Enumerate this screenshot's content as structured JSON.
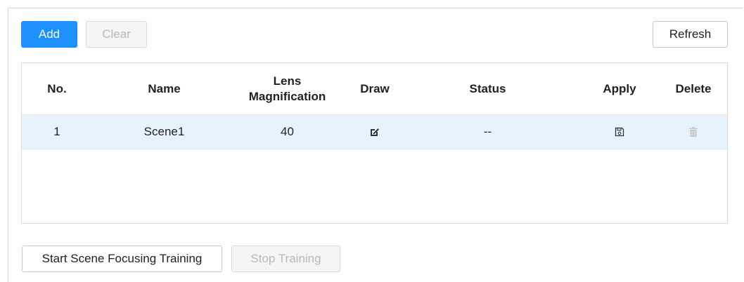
{
  "toolbar": {
    "add_label": "Add",
    "clear_label": "Clear",
    "refresh_label": "Refresh"
  },
  "table": {
    "columns": {
      "no": "No.",
      "name": "Name",
      "lens_magnification_line1": "Lens",
      "lens_magnification_line2": "Magnification",
      "draw": "Draw",
      "status": "Status",
      "apply": "Apply",
      "delete": "Delete"
    },
    "rows": [
      {
        "no": "1",
        "name": "Scene1",
        "lens_magnification": "40",
        "draw_icon": "edit-icon",
        "status": "--",
        "apply_icon": "save-icon",
        "delete_icon": "trash-icon"
      }
    ]
  },
  "footer": {
    "start_label": "Start Scene Focusing Training",
    "stop_label": "Stop Training"
  },
  "colors": {
    "primary": "#1e90ff",
    "selected_row": "#e6f3fc",
    "disabled_text": "#b8b8b8",
    "delete_icon_disabled": "#c8c8c8"
  }
}
